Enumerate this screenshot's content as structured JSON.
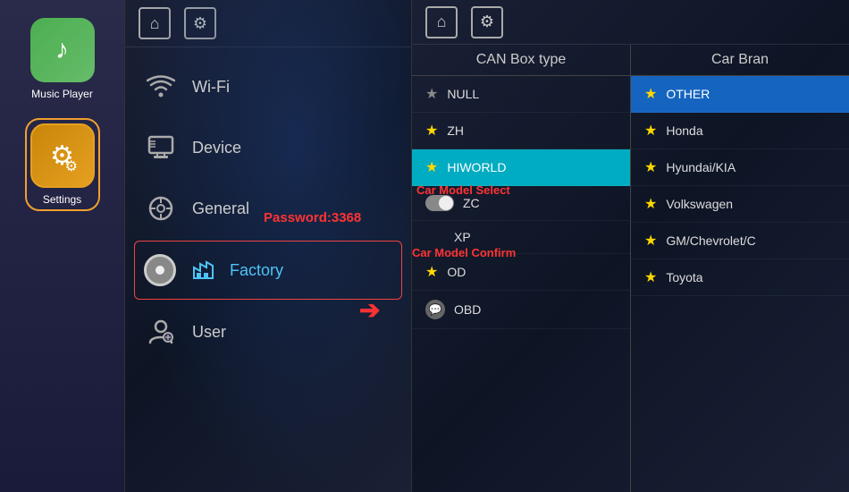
{
  "sidebar": {
    "apps": [
      {
        "id": "music-player",
        "label": "Music Player",
        "icon": "♪",
        "icon_style": "music"
      },
      {
        "id": "settings",
        "label": "Settings",
        "icon": "⚙",
        "icon_style": "settings",
        "active": true
      }
    ]
  },
  "settings_panel": {
    "top_bar": {
      "home_icon": "⌂",
      "gear_icon": "⚙"
    },
    "menu_items": [
      {
        "id": "wifi",
        "label": "Wi-Fi",
        "icon": "wifi"
      },
      {
        "id": "device",
        "label": "Device",
        "icon": "device"
      },
      {
        "id": "general",
        "label": "General",
        "icon": "general"
      },
      {
        "id": "factory",
        "label": "Factory",
        "icon": "factory",
        "active": true
      },
      {
        "id": "user",
        "label": "User",
        "icon": "user"
      }
    ],
    "password_label": "Password:3368"
  },
  "car_model_panel": {
    "top_bar": {
      "home_icon": "⌂",
      "gear_icon": "⚙"
    },
    "can_box": {
      "header": "CAN Box type",
      "items": [
        {
          "id": "null",
          "label": "NULL",
          "star": false,
          "selected": false
        },
        {
          "id": "zh",
          "label": "ZH",
          "star": true,
          "selected": false
        },
        {
          "id": "hiworld",
          "label": "HIWORLD",
          "star": true,
          "selected": true
        },
        {
          "id": "zc",
          "label": "ZC",
          "star": false,
          "toggle": true,
          "selected": false
        },
        {
          "id": "xp",
          "label": "XP",
          "star": false,
          "selected": false
        },
        {
          "id": "od",
          "label": "OD",
          "star": true,
          "selected": false
        },
        {
          "id": "obd",
          "label": "OBD",
          "star": false,
          "chat": true,
          "selected": false
        }
      ]
    },
    "car_brand": {
      "header": "Car Bran",
      "items": [
        {
          "id": "other",
          "label": "OTHER",
          "star": true,
          "gold": true,
          "selected": true
        },
        {
          "id": "honda",
          "label": "Honda",
          "star": true,
          "selected": false
        },
        {
          "id": "hyundai",
          "label": "Hyundai/KIA",
          "star": true,
          "selected": false
        },
        {
          "id": "volkswagen",
          "label": "Volkswagen",
          "star": true,
          "selected": false
        },
        {
          "id": "gm",
          "label": "GM/Chevrolet/C",
          "star": true,
          "selected": false
        },
        {
          "id": "toyota",
          "label": "Toyota",
          "star": true,
          "selected": false
        }
      ]
    },
    "annotations": {
      "car_model_select": "Car Model Select",
      "car_model_confirm": "Car Model Confirm"
    }
  }
}
